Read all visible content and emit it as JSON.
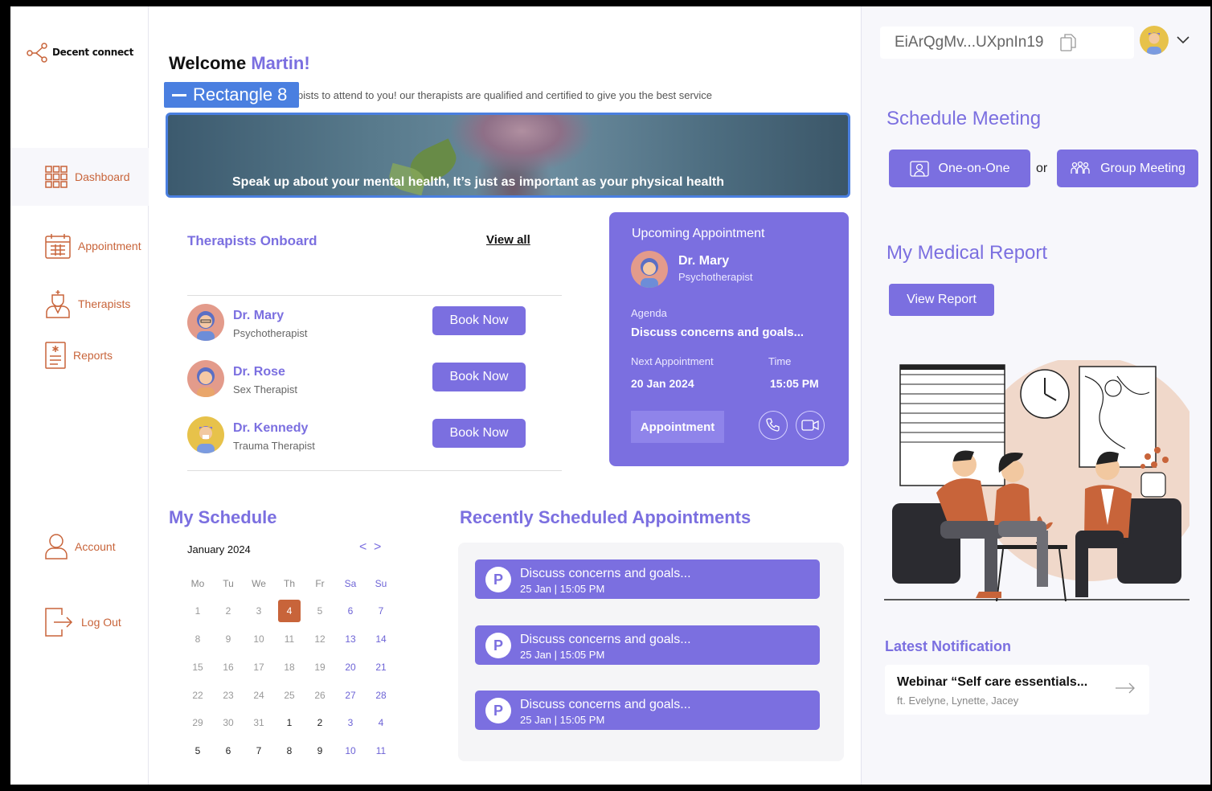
{
  "app": {
    "name": "Decent connect"
  },
  "sidebar": {
    "items": [
      {
        "label": "Dashboard",
        "active": true
      },
      {
        "label": "Appointment"
      },
      {
        "label": "Therapists"
      },
      {
        "label": "Reports"
      }
    ],
    "account_label": "Account",
    "logout_label": "Log Out"
  },
  "welcome": {
    "greeting": "Welcome",
    "name": "Martin!"
  },
  "subtitle": "pists to attend to you! our therapists are qualified  and  certified to give you the best service",
  "overlay_badge": "Rectangle 8",
  "banner": {
    "text": "Speak up about your mental health, It’s just as important as your physical health"
  },
  "therapists": {
    "title": "Therapists Onboard",
    "view_all": "View all",
    "list": [
      {
        "name": "Dr. Mary",
        "role": "Psychotherapist",
        "button": "Book Now"
      },
      {
        "name": "Dr. Rose",
        "role": "Sex Therapist",
        "button": "Book Now"
      },
      {
        "name": "Dr. Kennedy",
        "role": "Trauma Therapist",
        "button": "Book Now"
      }
    ]
  },
  "upcoming": {
    "title": "Upcoming Appointment",
    "doctor_name": "Dr. Mary",
    "doctor_role": "Psychotherapist",
    "agenda_label": "Agenda",
    "agenda": "Discuss concerns and goals...",
    "next_label": "Next Appointment",
    "next_value": "20 Jan 2024",
    "time_label": "Time",
    "time_value": "15:05 PM",
    "button": "Appointment"
  },
  "schedule": {
    "title": "My Schedule",
    "month": "January 2024",
    "prev": "<",
    "next": ">",
    "weekdays": [
      "Mo",
      "Tu",
      "We",
      "Th",
      "Fr",
      "Sa",
      "Su"
    ],
    "weeks": [
      [
        "1",
        "2",
        "3",
        "4",
        "5",
        "6",
        "7"
      ],
      [
        "8",
        "9",
        "10",
        "11",
        "12",
        "13",
        "14"
      ],
      [
        "15",
        "16",
        "17",
        "18",
        "19",
        "20",
        "21"
      ],
      [
        "22",
        "23",
        "24",
        "25",
        "26",
        "27",
        "28"
      ],
      [
        "29",
        "30",
        "31",
        "1",
        "2",
        "3",
        "4"
      ],
      [
        "5",
        "6",
        "7",
        "8",
        "9",
        "10",
        "11"
      ]
    ],
    "selected_day": "4"
  },
  "recent": {
    "title": "Recently Scheduled Appointments",
    "items": [
      {
        "badge": "P",
        "title": "Discuss concerns and goals...",
        "meta": "25 Jan | 15:05 PM"
      },
      {
        "badge": "P",
        "title": "Discuss concerns and goals...",
        "meta": "25 Jan | 15:05 PM"
      },
      {
        "badge": "P",
        "title": "Discuss concerns and goals...",
        "meta": "25 Jan | 15:05 PM"
      }
    ]
  },
  "right": {
    "wallet_address": "EiArQgMv...UXpnIn19",
    "schedule_title": "Schedule Meeting",
    "one_on_one": "One-on-One",
    "or": "or",
    "group_meeting": "Group Meeting",
    "report_title": "My Medical Report",
    "view_report": "View Report",
    "notif_title": "Latest Notification",
    "notif_headline": "Webinar “Self care essentials...",
    "notif_sub": "ft. Evelyne, Lynette, Jacey"
  },
  "colors": {
    "accent": "#7b6fe0",
    "nav": "#c8643a",
    "highlight": "#4a7fe0"
  }
}
